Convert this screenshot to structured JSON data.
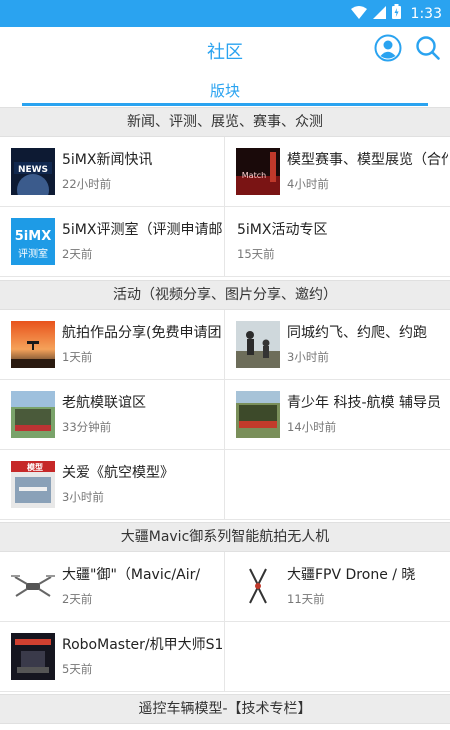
{
  "status_bar": {
    "time": "1:33"
  },
  "header": {
    "title": "社区"
  },
  "tab": {
    "label": "版块"
  },
  "sections": {
    "news": {
      "title": "新闻、评测、展览、赛事、众测",
      "items": [
        {
          "title": "5iMX新闻快讯",
          "time": "22小时前",
          "thumb_label": "NEWS"
        },
        {
          "title": "模型赛事、模型展览（合作",
          "time": "4小时前",
          "thumb_label": "Match"
        },
        {
          "title": "5iMX评测室（评测申请邮",
          "time": "2天前",
          "thumb_label": "5iMX",
          "thumb_sub": "评测室"
        },
        {
          "title": "5iMX活动专区",
          "time": "15天前"
        }
      ]
    },
    "activity": {
      "title": "活动（视频分享、图片分享、邀约）",
      "items": [
        {
          "title": "航拍作品分享(免费申请团",
          "time": "1天前"
        },
        {
          "title": "同城约飞、约爬、约跑",
          "time": "3小时前"
        },
        {
          "title": "老航模联谊区",
          "time": "33分钟前"
        },
        {
          "title": "青少年 科技-航模 辅导员",
          "time": "14小时前"
        },
        {
          "title": "关爱《航空模型》",
          "time": "3小时前",
          "thumb_label": "模型"
        }
      ]
    },
    "dji": {
      "title": "大疆Mavic御系列智能航拍无人机",
      "items": [
        {
          "title": "大疆\"御\"（Mavic/Air/",
          "time": "2天前"
        },
        {
          "title": "大疆FPV Drone / 晓",
          "time": "11天前"
        },
        {
          "title": "RoboMaster/机甲大师S1/",
          "time": "5天前"
        }
      ]
    },
    "rc_car": {
      "title": "遥控车辆模型-【技术专栏】"
    }
  }
}
